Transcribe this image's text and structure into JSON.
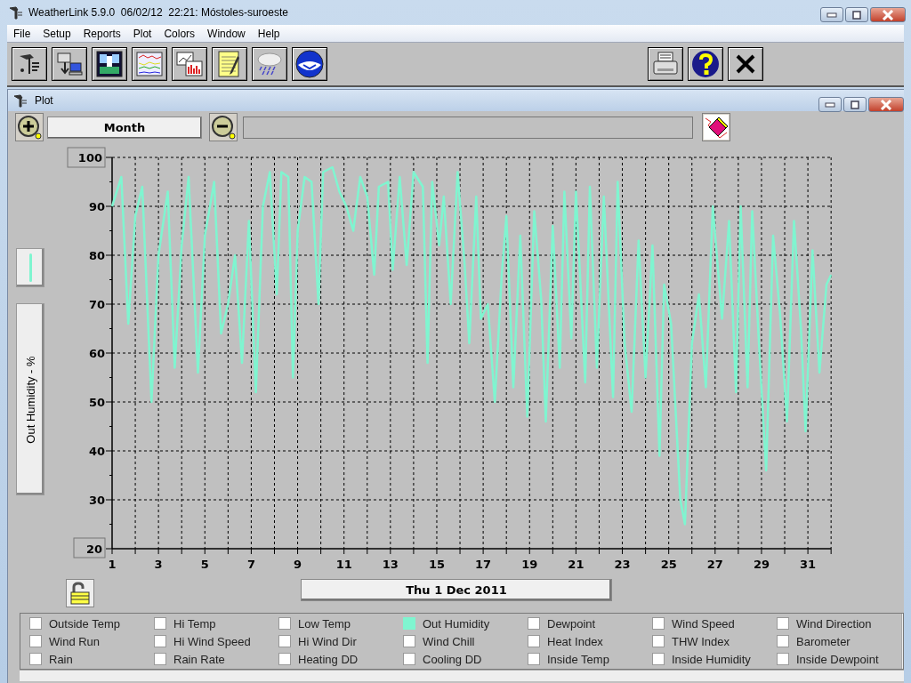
{
  "window": {
    "title": "WeatherLink 5.9.0  06/02/12  22:21: Móstoles-suroeste"
  },
  "menu": [
    "File",
    "Setup",
    "Reports",
    "Plot",
    "Colors",
    "Window",
    "Help"
  ],
  "plot_window": {
    "title": "Plot",
    "span": "Month",
    "date": "Thu 1 Dec 2011",
    "y_max": "100",
    "y_min": "20",
    "chart_data": {
      "type": "line",
      "grid": true,
      "ylabel": "Out Humidity - %",
      "xlim": [
        1,
        32
      ],
      "ylim": [
        20,
        100
      ],
      "xticks": [
        1,
        3,
        5,
        7,
        9,
        11,
        13,
        15,
        17,
        19,
        21,
        23,
        25,
        27,
        29,
        31
      ],
      "yticks": [
        30,
        40,
        50,
        60,
        70,
        80,
        90
      ],
      "x": [
        1.0,
        1.4,
        1.7,
        2.0,
        2.3,
        2.7,
        3.0,
        3.4,
        3.7,
        4.0,
        4.3,
        4.7,
        5.0,
        5.4,
        5.7,
        6.0,
        6.3,
        6.6,
        6.9,
        7.2,
        7.5,
        7.8,
        8.1,
        8.3,
        8.6,
        8.8,
        9.0,
        9.3,
        9.6,
        9.9,
        10.1,
        10.5,
        10.8,
        11.1,
        11.4,
        11.7,
        12.0,
        12.3,
        12.5,
        12.9,
        13.1,
        13.4,
        13.7,
        14.0,
        14.4,
        14.6,
        14.8,
        15.1,
        15.3,
        15.6,
        15.9,
        16.2,
        16.4,
        16.7,
        16.9,
        17.2,
        17.5,
        17.8,
        18.0,
        18.3,
        18.6,
        18.9,
        19.2,
        19.5,
        19.7,
        20.0,
        20.3,
        20.5,
        20.8,
        21.0,
        21.4,
        21.6,
        21.9,
        22.2,
        22.6,
        22.8,
        23.1,
        23.4,
        23.7,
        24.0,
        24.3,
        24.6,
        24.8,
        25.1,
        25.5,
        25.7,
        26.0,
        26.3,
        26.6,
        26.9,
        27.3,
        27.6,
        27.9,
        28.1,
        28.4,
        28.6,
        28.9,
        29.2,
        29.5,
        29.8,
        30.1,
        30.4,
        30.7,
        30.9,
        31.2,
        31.5,
        31.8,
        32.0
      ],
      "series": [
        {
          "color": "#7ff5d0",
          "values": [
            90,
            96,
            66,
            88,
            94,
            50,
            80,
            93,
            57,
            82,
            96,
            56,
            84,
            95,
            64,
            70,
            80,
            58,
            87,
            52,
            90,
            97,
            72,
            97,
            96,
            55,
            85,
            96,
            95,
            70,
            97,
            98,
            93,
            90,
            85,
            96,
            92,
            76,
            94,
            95,
            77,
            96,
            78,
            97,
            94,
            58,
            95,
            82,
            92,
            70,
            97,
            78,
            62,
            92,
            67,
            70,
            50,
            76,
            88,
            53,
            84,
            47,
            89,
            71,
            46,
            86,
            57,
            93,
            63,
            93,
            54,
            94,
            57,
            92,
            51,
            95,
            62,
            48,
            83,
            55,
            82,
            39,
            74,
            66,
            30,
            25,
            62,
            72,
            53,
            90,
            67,
            87,
            52,
            90,
            53,
            89,
            61,
            36,
            84,
            68,
            46,
            87,
            65,
            44,
            81,
            56,
            74,
            76
          ]
        }
      ]
    }
  },
  "series_options": [
    {
      "label": "Outside Temp",
      "checked": false
    },
    {
      "label": "Hi Temp",
      "checked": false
    },
    {
      "label": "Low Temp",
      "checked": false
    },
    {
      "label": "Out Humidity",
      "checked": true
    },
    {
      "label": "Dewpoint",
      "checked": false
    },
    {
      "label": "Wind Speed",
      "checked": false
    },
    {
      "label": "Wind Direction",
      "checked": false
    },
    {
      "label": "Wind Run",
      "checked": false
    },
    {
      "label": "Hi Wind Speed",
      "checked": false
    },
    {
      "label": "Hi Wind Dir",
      "checked": false
    },
    {
      "label": "Wind Chill",
      "checked": false
    },
    {
      "label": "Heat Index",
      "checked": false
    },
    {
      "label": "THW Index",
      "checked": false
    },
    {
      "label": "Barometer",
      "checked": false
    },
    {
      "label": "Rain",
      "checked": false
    },
    {
      "label": "Rain Rate",
      "checked": false
    },
    {
      "label": "Heating DD",
      "checked": false
    },
    {
      "label": "Cooling DD",
      "checked": false
    },
    {
      "label": "Inside Temp",
      "checked": false
    },
    {
      "label": "Inside Humidity",
      "checked": false
    },
    {
      "label": "Inside Dewpoint",
      "checked": false
    }
  ]
}
